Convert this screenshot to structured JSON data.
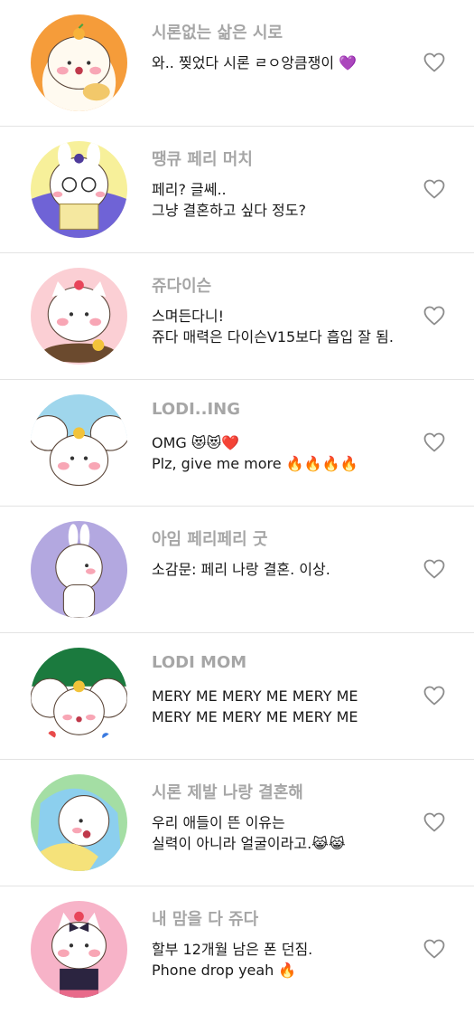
{
  "posts": [
    {
      "name": "시론없는 삶은 시로",
      "lines": [
        "와.. 찢었다 시론 ㄹㅇ앙큼쟁이 💜"
      ],
      "avatar_bg": "#f59c3a"
    },
    {
      "name": "땡큐 페리 머치",
      "lines": [
        "페리? 글쎄..",
        "그냥 결혼하고 싶다 정도?"
      ],
      "avatar_bg": "#f7f09a"
    },
    {
      "name": "쥬다이슨",
      "lines": [
        "스며든다니!",
        "쥬다 매력은 다이슨V15보다 흡입 잘 됨."
      ],
      "avatar_bg": "#fbcfd4"
    },
    {
      "name": "LODI..ING",
      "lines": [
        "OMG 😻😻❤️",
        "Plz, give me more 🔥🔥🔥🔥"
      ],
      "avatar_bg": "#9fd6ec"
    },
    {
      "name": "아임 페리페리 굿",
      "lines": [
        "소감문: 페리 나랑 결혼. 이상."
      ],
      "avatar_bg": "#b3a8e0"
    },
    {
      "name": "LODI MOM",
      "lines": [
        "MERY ME MERY ME MERY ME",
        "MERY ME MERY ME MERY ME"
      ],
      "avatar_bg": "#1b7a3e"
    },
    {
      "name": "시론 제발 나랑 결혼해",
      "lines": [
        "우리 애들이 뜬 이유는",
        "실력이 아니라 얼굴이라고.😹😹"
      ],
      "avatar_bg": "#a4dea4"
    },
    {
      "name": "내 맘을 다 쥬다",
      "lines": [
        "할부 12개월 남은 폰 던짐.",
        "Phone drop yeah 🔥"
      ],
      "avatar_bg": "#f7b3c8"
    }
  ],
  "like_icon": "heart-outline-icon",
  "colors": {
    "username": "#a6a6a6",
    "text": "#1a1a1a",
    "divider": "#e3e3e3"
  }
}
